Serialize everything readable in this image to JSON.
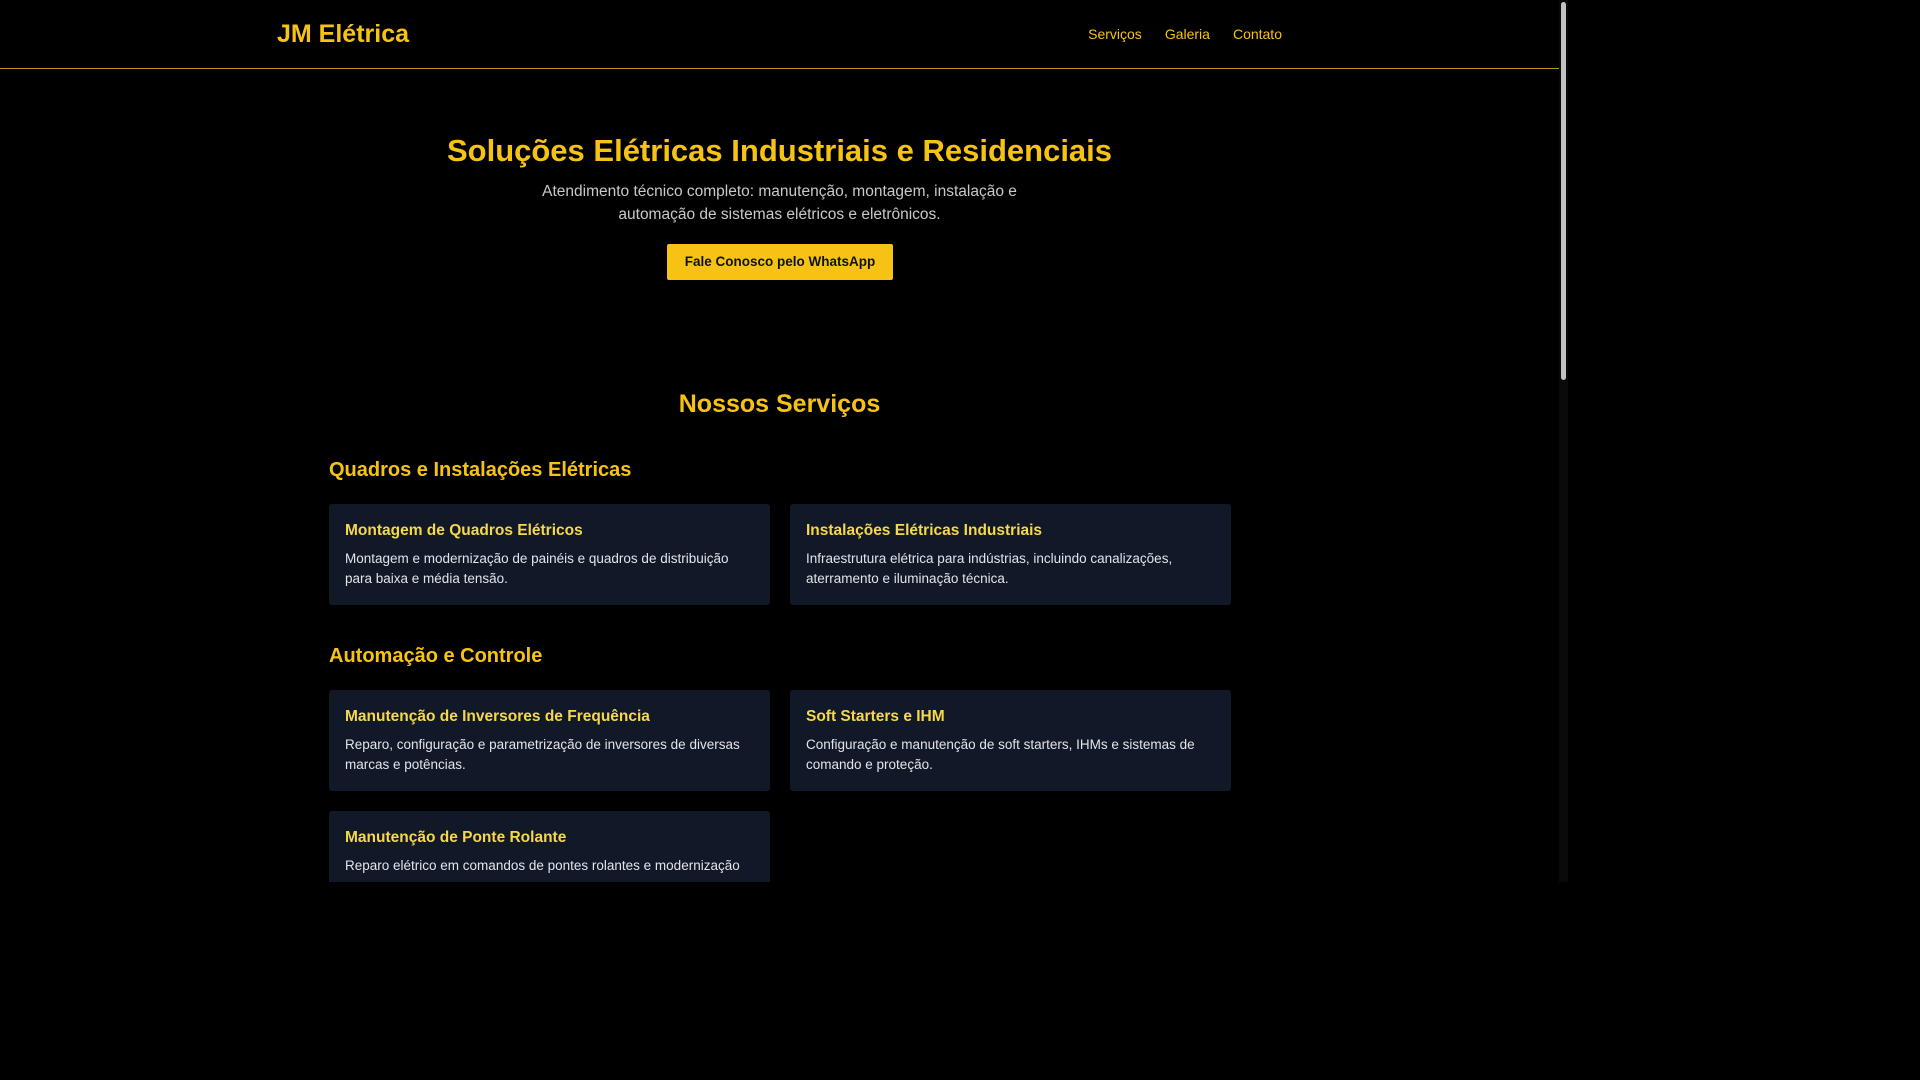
{
  "header": {
    "logo": "JM Elétrica",
    "nav": [
      "Serviços",
      "Galeria",
      "Contato"
    ]
  },
  "hero": {
    "title": "Soluções Elétricas Industriais e Residenciais",
    "subtitle": "Atendimento técnico completo: manutenção, montagem, instalação e automação de sistemas elétricos e eletrônicos.",
    "cta_label": "Fale Conosco pelo WhatsApp"
  },
  "services": {
    "title": "Nossos Serviços",
    "categories": [
      {
        "title": "Quadros e Instalações Elétricas",
        "items": [
          {
            "title": "Montagem de Quadros Elétricos",
            "description": "Montagem e modernização de painéis e quadros de distribuição para baixa e média tensão."
          },
          {
            "title": "Instalações Elétricas Industriais",
            "description": "Infraestrutura elétrica para indústrias, incluindo canalizações, aterramento e iluminação técnica."
          }
        ]
      },
      {
        "title": "Automação e Controle",
        "items": [
          {
            "title": "Manutenção de Inversores de Frequência",
            "description": "Reparo, configuração e parametrização de inversores de diversas marcas e potências."
          },
          {
            "title": "Soft Starters e IHM",
            "description": "Configuração e manutenção de soft starters, IHMs e sistemas de comando e proteção."
          },
          {
            "title": "Manutenção de Ponte Rolante",
            "description": "Reparo elétrico em comandos de pontes rolantes e modernização"
          }
        ]
      }
    ]
  },
  "colors": {
    "background": "#000000",
    "accent": "#f6c315",
    "card_background": "#111827",
    "card_title": "#f6d84a",
    "text_muted": "#c9c9c9"
  }
}
